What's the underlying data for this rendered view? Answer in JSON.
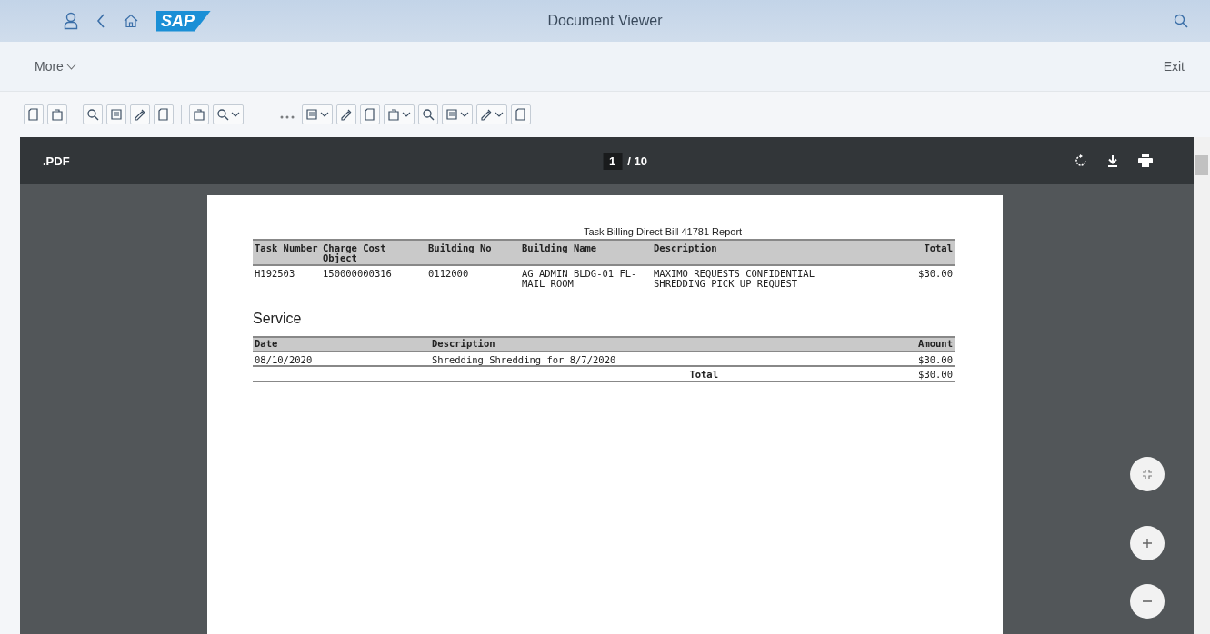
{
  "shell": {
    "title": "Document Viewer",
    "logo": "SAP"
  },
  "menu_bar": {
    "more": "More",
    "exit": "Exit"
  },
  "toolbar": [
    {
      "kind": "button",
      "dropdown": false
    },
    {
      "kind": "button",
      "dropdown": false
    },
    {
      "kind": "separator"
    },
    {
      "kind": "button",
      "dropdown": false
    },
    {
      "kind": "button",
      "dropdown": false
    },
    {
      "kind": "button",
      "dropdown": false
    },
    {
      "kind": "button",
      "dropdown": false
    },
    {
      "kind": "separator"
    },
    {
      "kind": "button",
      "dropdown": false
    },
    {
      "kind": "button",
      "dropdown": true
    },
    {
      "kind": "overflow"
    },
    {
      "kind": "button",
      "dropdown": true
    },
    {
      "kind": "button",
      "dropdown": false
    },
    {
      "kind": "button",
      "dropdown": false
    },
    {
      "kind": "button",
      "dropdown": true
    },
    {
      "kind": "button",
      "dropdown": false
    },
    {
      "kind": "button",
      "dropdown": true
    },
    {
      "kind": "button",
      "dropdown": true
    },
    {
      "kind": "button",
      "dropdown": false
    }
  ],
  "viewer": {
    "file_label": ".PDF",
    "page": "1",
    "page_total": "/ 10"
  },
  "document": {
    "title": "Task Billing Direct Bill 41781 Report",
    "bill_table": {
      "columns": [
        "Task Number",
        "Charge Cost Object",
        "Building No",
        "Building Name",
        "Description",
        "Total"
      ],
      "rows": [
        [
          "H192503",
          "150000000316",
          "0112000",
          "AG ADMIN BLDG-01 FL- MAIL ROOM",
          "MAXIMO REQUESTS CONFIDENTIAL SHREDDING PICK UP REQUEST",
          "$30.00"
        ]
      ]
    },
    "section": "Service",
    "service_table": {
      "columns": [
        "Date",
        "Description",
        "Amount"
      ],
      "rows": [
        [
          "08/10/2020",
          "Shredding Shredding for 8/7/2020",
          "$30.00"
        ]
      ],
      "total_label": "Total",
      "total": "$30.00"
    }
  }
}
